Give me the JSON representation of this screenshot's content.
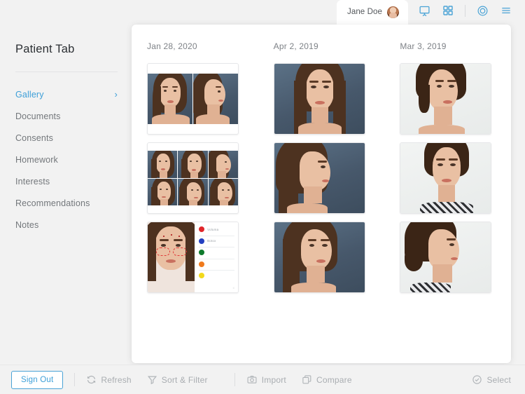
{
  "topbar": {
    "patient_tab": {
      "name": "Jane Doe",
      "avatar_icon": "avatar-photo"
    },
    "icons": [
      {
        "name": "presentation-icon",
        "label": "Presentation"
      },
      {
        "name": "grid-view-icon",
        "label": "Grid View"
      },
      {
        "name": "capture-target-icon",
        "label": "Capture"
      },
      {
        "name": "hamburger-menu-icon",
        "label": "Menu"
      }
    ],
    "accent_color": "#4aa3d6"
  },
  "sidebar": {
    "title": "Patient Tab",
    "items": [
      {
        "label": "Gallery",
        "active": true,
        "chevron": "›"
      },
      {
        "label": "Documents",
        "active": false
      },
      {
        "label": "Consents",
        "active": false
      },
      {
        "label": "Homework",
        "active": false
      },
      {
        "label": "Interests",
        "active": false
      },
      {
        "label": "Recommendations",
        "active": false
      },
      {
        "label": "Notes",
        "active": false
      }
    ]
  },
  "gallery": {
    "columns": [
      {
        "date": "Jan 28, 2020",
        "items": [
          {
            "kind": "pair",
            "caption": "Before and after front and profile pair",
            "background": "blue"
          },
          {
            "kind": "montage6",
            "caption": "Six view photo montage",
            "background": "blue"
          },
          {
            "kind": "treatment-map",
            "caption": "Facial treatment map with legend"
          }
        ]
      },
      {
        "date": "Apr 2, 2019",
        "items": [
          {
            "kind": "front",
            "caption": "Frontal portrait",
            "background": "blue"
          },
          {
            "kind": "profile",
            "caption": "Right profile portrait",
            "background": "blue"
          },
          {
            "kind": "three-quarter",
            "caption": "Three quarter portrait",
            "background": "blue"
          }
        ]
      },
      {
        "date": "Mar 3, 2019",
        "items": [
          {
            "kind": "three-quarter",
            "caption": "Three quarter portrait",
            "background": "white"
          },
          {
            "kind": "front",
            "caption": "Frontal portrait",
            "background": "white"
          },
          {
            "kind": "profile",
            "caption": "Right profile portrait",
            "background": "white"
          }
        ]
      }
    ],
    "treatment_legend": [
      {
        "label": "Voluma",
        "color": "#e0262a"
      },
      {
        "label": "Botox",
        "color": "#2340c0"
      },
      {
        "label": "",
        "color": "#0e7a2c"
      },
      {
        "label": "",
        "color": "#f07a1c"
      },
      {
        "label": "",
        "color": "#f2d91c"
      }
    ],
    "treatment_footer": "©"
  },
  "bottombar": {
    "sign_out": "Sign Out",
    "actions": [
      {
        "label": "Refresh",
        "icon": "refresh-icon"
      },
      {
        "label": "Sort & Filter",
        "icon": "funnel-icon"
      },
      {
        "label": "Import",
        "icon": "camera-icon"
      },
      {
        "label": "Compare",
        "icon": "compare-icon"
      }
    ],
    "select": {
      "label": "Select",
      "icon": "check-circle-icon"
    }
  }
}
